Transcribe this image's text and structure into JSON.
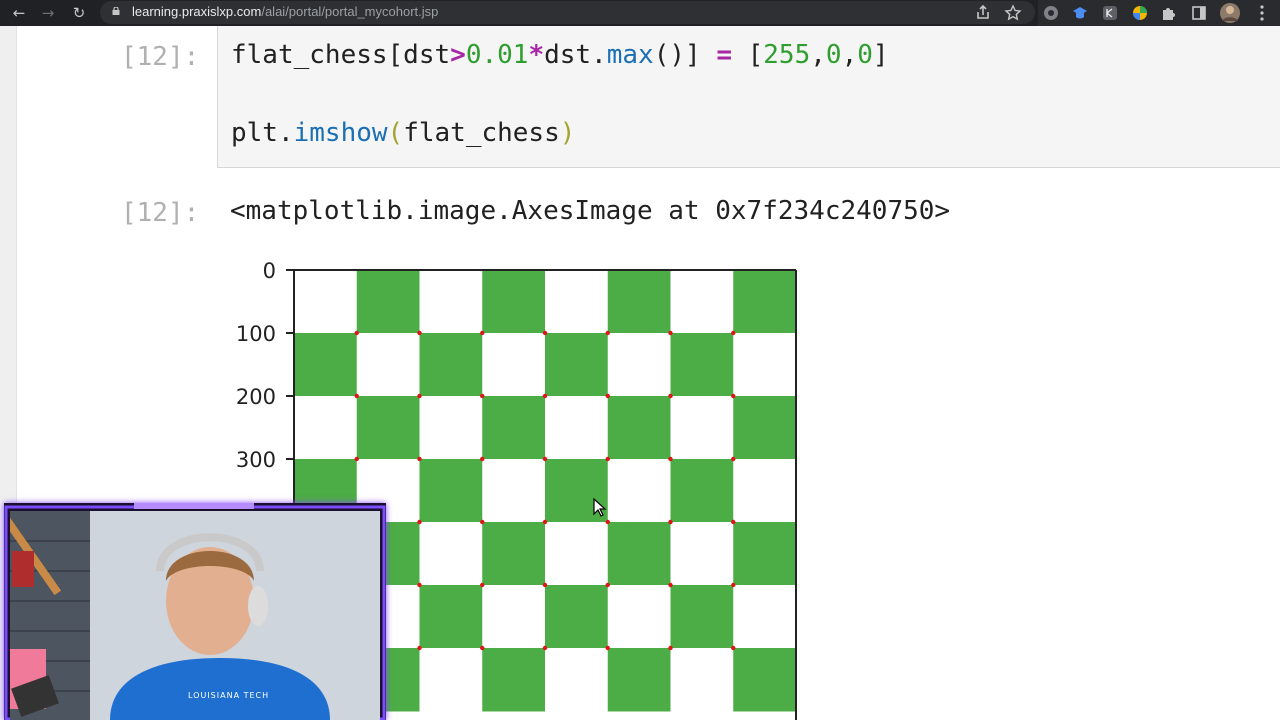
{
  "browser": {
    "url_host": "learning.praxislxp.com",
    "url_path": "/alai/portal/portal_mycohort.jsp",
    "nav": {
      "back_glyph": "←",
      "forward_glyph": "→",
      "reload_glyph": "↻"
    },
    "toolbar_icons": [
      "share-icon",
      "bookmark-star-icon",
      "extension-icon-1",
      "extension-icon-2",
      "extension-icon-3",
      "extension-icon-4",
      "extensions-puzzle-icon",
      "side-panel-icon",
      "profile-avatar-icon"
    ]
  },
  "notebook": {
    "input_prompt": "[12]:",
    "output_prompt": "[12]:",
    "code_line_1": {
      "a": "flat_chess[dst",
      "op1": ">",
      "num1": "0.01",
      "op2": "*",
      "b": "dst.",
      "fn1": "max",
      "c": "()] ",
      "op3": "=",
      "d": " [",
      "n2": "255",
      "e": ",",
      "n3": "0",
      "f": ",",
      "n4": "0",
      "g": "]"
    },
    "code_line_2": {
      "a": "plt.",
      "fn": "imshow",
      "p1": "(",
      "arg": "flat_chess",
      "p2": ")"
    },
    "output_text": "<matplotlib.image.AxesImage at 0x7f234c240750>"
  },
  "chart_data": {
    "type": "heatmap",
    "description_kind": "imshow of 8x8 chessboard image",
    "y_ticks": [
      "0",
      "100",
      "200",
      "300"
    ],
    "grid_cols": 8,
    "grid_rows_visible": 7,
    "colors": {
      "green": "#4cac45",
      "white": "#ffffff",
      "corner": "#e01515"
    },
    "cells": [
      [
        0,
        1,
        0,
        1,
        0,
        1,
        0,
        1
      ],
      [
        1,
        0,
        1,
        0,
        1,
        0,
        1,
        0
      ],
      [
        0,
        1,
        0,
        1,
        0,
        1,
        0,
        1
      ],
      [
        1,
        0,
        1,
        0,
        1,
        0,
        1,
        0
      ],
      [
        0,
        1,
        0,
        1,
        0,
        1,
        0,
        1
      ],
      [
        1,
        0,
        1,
        0,
        1,
        0,
        1,
        0
      ],
      [
        0,
        1,
        0,
        1,
        0,
        1,
        0,
        1
      ]
    ]
  },
  "webcam": {
    "shirt_text": "LOUISIANA TECH"
  }
}
